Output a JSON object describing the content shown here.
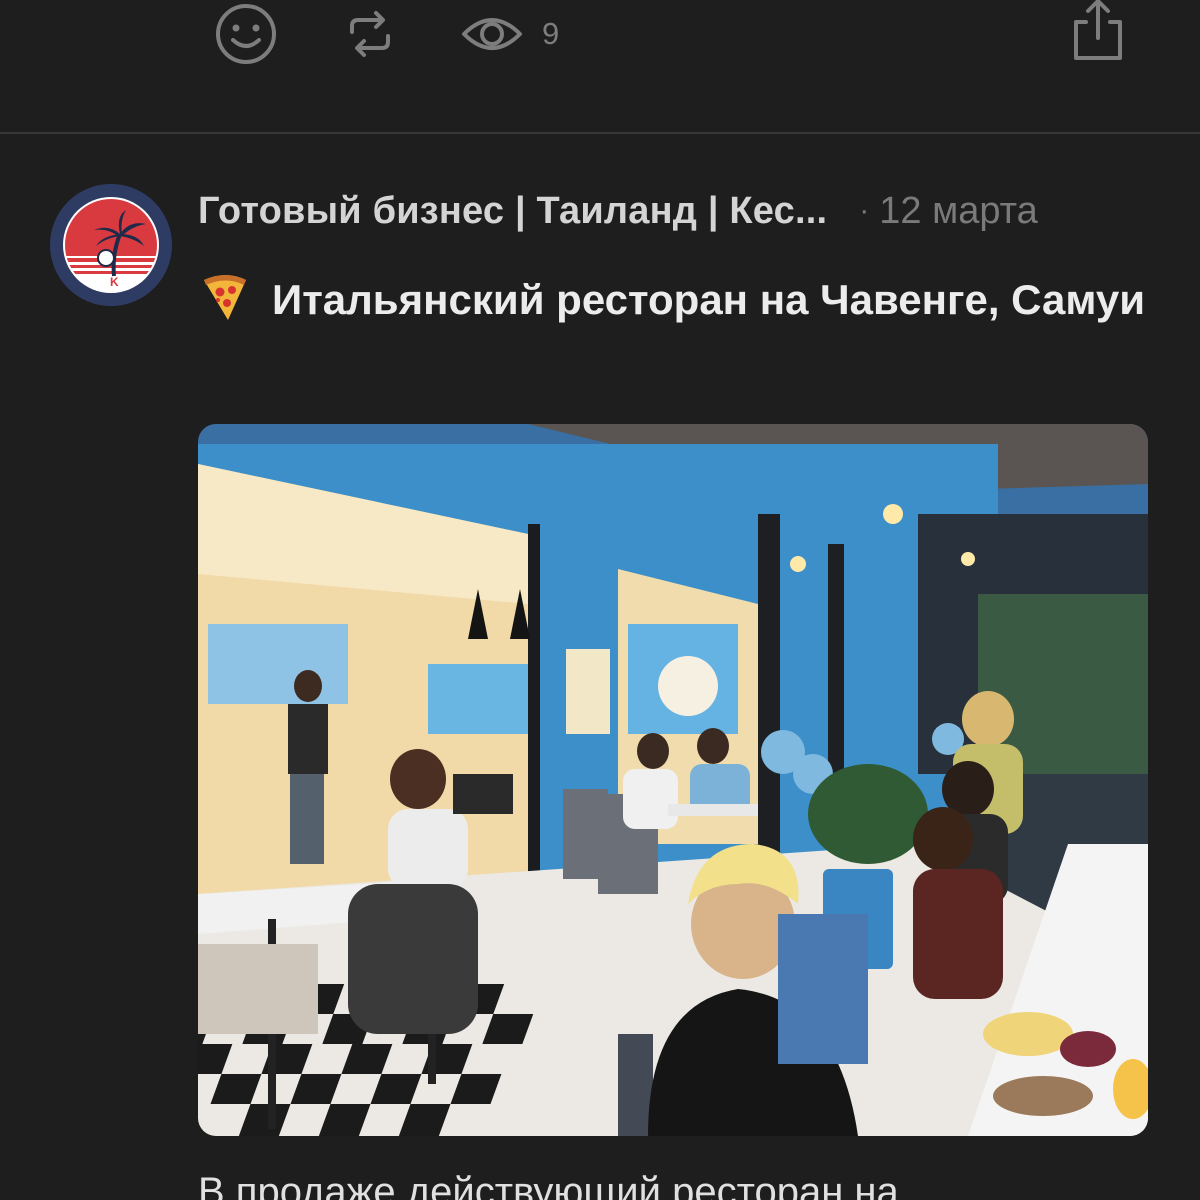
{
  "actions": {
    "reaction_icon": "smile-icon",
    "repost_icon": "repost-icon",
    "views_icon": "eye-icon",
    "views_count": "9",
    "share_icon": "share-icon"
  },
  "post": {
    "channel_name": "Готовый бизнес | Таиланд | Кес...",
    "separator": "·",
    "date": "12 марта",
    "title_emoji": "pizza-emoji",
    "title": "Итальянский ресторан на Чавенге, Самуи",
    "photo_description": "restaurant-photo",
    "text": "В продаже действующий ресторан на"
  },
  "colors": {
    "background": "#1e1e1e",
    "icon": "#7d7d7d",
    "avatar_bg": "#2e3b63",
    "avatar_red": "#d83a3f"
  }
}
